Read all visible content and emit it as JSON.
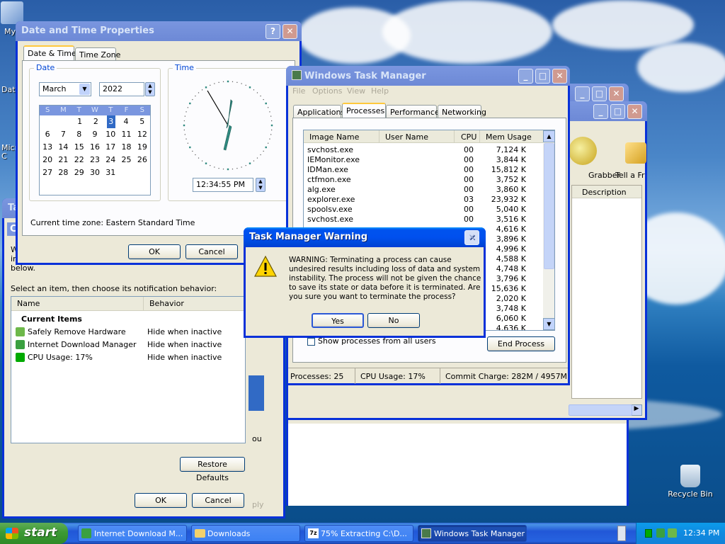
{
  "desktop": {
    "icons": [
      "My",
      "Date",
      "Micro C",
      "Recycle Bin"
    ]
  },
  "datetime": {
    "title": "Date and Time Properties",
    "tabs": [
      "Date & Time",
      "Time Zone"
    ],
    "date_group": "Date",
    "month": "March",
    "year": "2022",
    "days_header": [
      "S",
      "M",
      "T",
      "W",
      "T",
      "F",
      "S"
    ],
    "weeks": [
      [
        "",
        "",
        "1",
        "2",
        "3",
        "4",
        "5"
      ],
      [
        "6",
        "7",
        "8",
        "9",
        "10",
        "11",
        "12"
      ],
      [
        "13",
        "14",
        "15",
        "16",
        "17",
        "18",
        "19"
      ],
      [
        "20",
        "21",
        "22",
        "23",
        "24",
        "25",
        "26"
      ],
      [
        "27",
        "28",
        "29",
        "30",
        "31",
        "",
        ""
      ]
    ],
    "selected_day": "3",
    "time_group": "Time",
    "time": "12:34:55 PM",
    "timezone": "Current time zone:  Eastern Standard Time",
    "ok": "OK",
    "cancel": "Cancel"
  },
  "notify": {
    "title_frag": "Ta",
    "sub_frag": "Cu",
    "intro_1": "W",
    "intro_2": "in",
    "intro_3": "below.",
    "select_label": "Select an item, then choose its notification behavior:",
    "col_name": "Name",
    "col_behavior": "Behavior",
    "section": "Current Items",
    "items": [
      {
        "name": "Safely Remove Hardware",
        "behavior": "Hide when inactive"
      },
      {
        "name": "Internet Download Manager",
        "behavior": "Hide when inactive"
      },
      {
        "name": "CPU Usage: 17%",
        "behavior": "Hide when inactive"
      }
    ],
    "restore": "Restore Defaults",
    "ok": "OK",
    "cancel": "Cancel",
    "frag_u": "ou",
    "frag_ply": "ply"
  },
  "taskmgr": {
    "title": "Windows Task Manager",
    "menu": [
      "File",
      "Options",
      "View",
      "Help"
    ],
    "tabs": [
      "Applications",
      "Processes",
      "Performance",
      "Networking"
    ],
    "columns": [
      "Image Name",
      "User Name",
      "CPU",
      "Mem Usage"
    ],
    "rows": [
      [
        "svchost.exe",
        "",
        "00",
        "7,124 K"
      ],
      [
        "IEMonitor.exe",
        "",
        "00",
        "3,844 K"
      ],
      [
        "IDMan.exe",
        "",
        "00",
        "15,812 K"
      ],
      [
        "ctfmon.exe",
        "",
        "00",
        "3,752 K"
      ],
      [
        "alg.exe",
        "",
        "00",
        "3,860 K"
      ],
      [
        "explorer.exe",
        "",
        "03",
        "23,932 K"
      ],
      [
        "spoolsv.exe",
        "",
        "00",
        "5,040 K"
      ],
      [
        "svchost.exe",
        "",
        "00",
        "3,516 K"
      ],
      [
        "",
        "",
        "",
        "4,616 K"
      ],
      [
        "",
        "",
        "",
        "3,896 K"
      ],
      [
        "",
        "",
        "",
        "4,996 K"
      ],
      [
        "",
        "",
        "",
        "4,588 K"
      ],
      [
        "",
        "",
        "",
        "4,748 K"
      ],
      [
        "",
        "",
        "",
        "3,796 K"
      ],
      [
        "",
        "",
        "",
        "15,636 K"
      ],
      [
        "",
        "",
        "",
        "2,020 K"
      ],
      [
        "",
        "",
        "",
        "3,748 K"
      ],
      [
        "",
        "",
        "",
        "6,060 K"
      ],
      [
        "",
        "",
        "",
        "4,636 K"
      ]
    ],
    "show_all": "Show processes from all users",
    "end_process": "End Process",
    "status": [
      "Processes: 25",
      "CPU Usage: 17%",
      "Commit Charge: 282M / 4957M"
    ]
  },
  "warning": {
    "title": "Task Manager Warning",
    "message": "WARNING: Terminating a process can cause undesired results including loss of data and system instability. The process will not be given the chance to save its state or data before it is terminated.  Are you sure you want to terminate the process?",
    "yes": "Yes",
    "no": "No"
  },
  "backwin": {
    "tools": [
      "Grabber",
      "Tell a Frie"
    ],
    "col": "Description"
  },
  "taskbar": {
    "start": "start",
    "tasks": [
      "Internet Download M...",
      "Downloads",
      "75% Extracting C:\\D...",
      "Windows Task Manager"
    ],
    "clock": "12:34 PM"
  },
  "colors": {
    "xp_blue": "#0054e3",
    "button_face": "#ece9d8",
    "selection": "#316ac5"
  }
}
